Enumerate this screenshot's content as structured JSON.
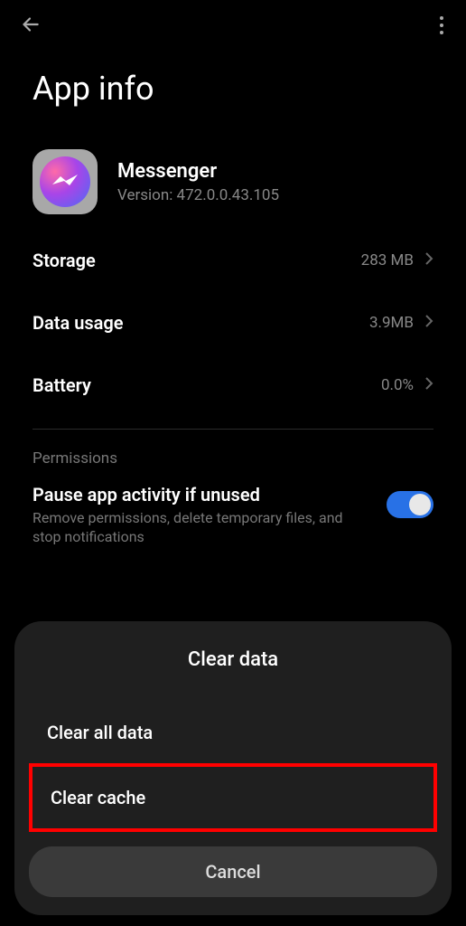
{
  "header": {
    "title": "App info"
  },
  "app": {
    "name": "Messenger",
    "version_text": "Version: 472.0.0.43.105"
  },
  "rows": {
    "storage": {
      "label": "Storage",
      "value": "283 MB"
    },
    "data_usage": {
      "label": "Data usage",
      "value": "3.9MB"
    },
    "battery": {
      "label": "Battery",
      "value": "0.0%"
    }
  },
  "permissions": {
    "section_label": "Permissions",
    "pause_title": "Pause app activity if unused",
    "pause_desc": "Remove permissions, delete temporary files, and stop notifications"
  },
  "sheet": {
    "title": "Clear data",
    "option_all": "Clear all data",
    "option_cache": "Clear cache",
    "cancel": "Cancel"
  }
}
